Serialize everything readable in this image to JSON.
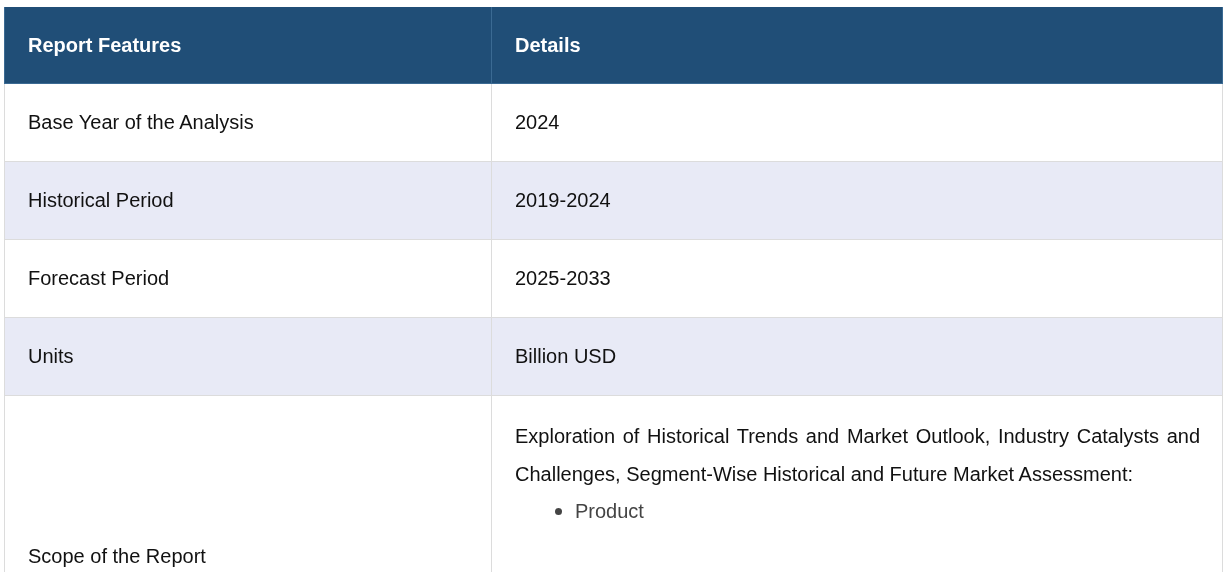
{
  "table": {
    "columns": [
      "Report Features",
      "Details"
    ],
    "rows": [
      {
        "feature": "Base Year of the Analysis",
        "details": "2024"
      },
      {
        "feature": "Historical Period",
        "details": "2019-2024"
      },
      {
        "feature": "Forecast Period",
        "details": "2025-2033"
      },
      {
        "feature": "Units",
        "details": "Billion USD"
      },
      {
        "feature": "Scope of the Report",
        "details": "Exploration of Historical Trends and Market Outlook, Industry Catalysts and Challenges, Segment-Wise Historical and Future Market Assessment:",
        "bullets": [
          "Product"
        ]
      }
    ]
  }
}
